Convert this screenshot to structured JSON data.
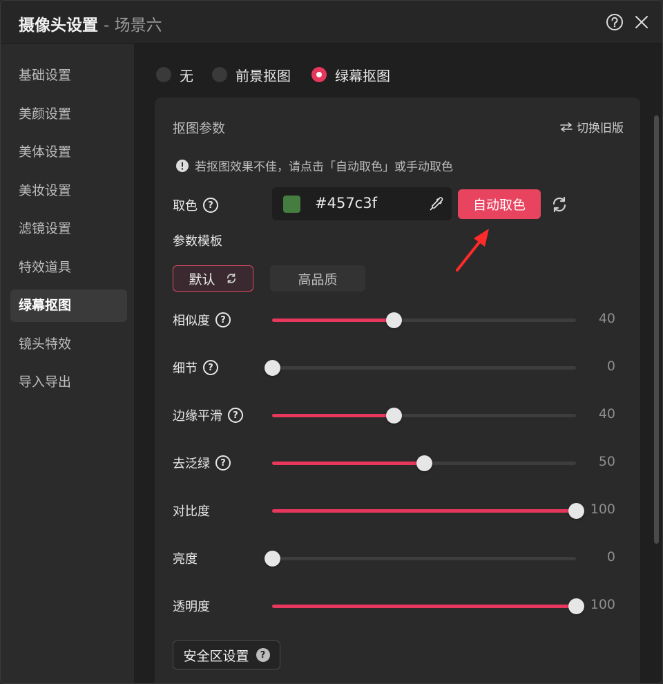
{
  "window": {
    "title": "摄像头设置",
    "scene": "- 场景六",
    "help_icon": "help-circle-icon",
    "close_icon": "close-icon"
  },
  "sidebar": {
    "items": [
      {
        "label": "基础设置",
        "active": false
      },
      {
        "label": "美颜设置",
        "active": false
      },
      {
        "label": "美体设置",
        "active": false
      },
      {
        "label": "美妆设置",
        "active": false
      },
      {
        "label": "滤镜设置",
        "active": false
      },
      {
        "label": "特效道具",
        "active": false
      },
      {
        "label": "绿幕抠图",
        "active": true
      },
      {
        "label": "镜头特效",
        "active": false
      },
      {
        "label": "导入导出",
        "active": false
      }
    ]
  },
  "mode": {
    "options": [
      {
        "label": "无",
        "checked": false
      },
      {
        "label": "前景抠图",
        "checked": false
      },
      {
        "label": "绿幕抠图",
        "checked": true
      }
    ]
  },
  "panel": {
    "title": "抠图参数",
    "switch_old": "切换旧版",
    "tip": "若抠图效果不佳，请点击「自动取色」或手动取色",
    "color_label": "取色",
    "color_hex": "#457c3f",
    "color_value": "#457c3f",
    "auto_pick_label": "自动取色",
    "template_label": "参数模板",
    "templates": {
      "default": "默认",
      "high_quality": "高品质"
    },
    "sliders": [
      {
        "label": "相似度",
        "value": 40,
        "max": 100,
        "help": true
      },
      {
        "label": "细节",
        "value": 0,
        "max": 100,
        "help": true
      },
      {
        "label": "边缘平滑",
        "value": 40,
        "max": 100,
        "help": true
      },
      {
        "label": "去泛绿",
        "value": 50,
        "max": 100,
        "help": true
      },
      {
        "label": "对比度",
        "value": 100,
        "max": 100,
        "help": false
      },
      {
        "label": "亮度",
        "value": 0,
        "max": 100,
        "help": false
      },
      {
        "label": "透明度",
        "value": 100,
        "max": 100,
        "help": false
      }
    ],
    "safe_zone_label": "安全区设置"
  },
  "colors": {
    "accent": "#e8375c",
    "button": "#e8435f",
    "annotation_arrow": "#ff2a2a"
  }
}
